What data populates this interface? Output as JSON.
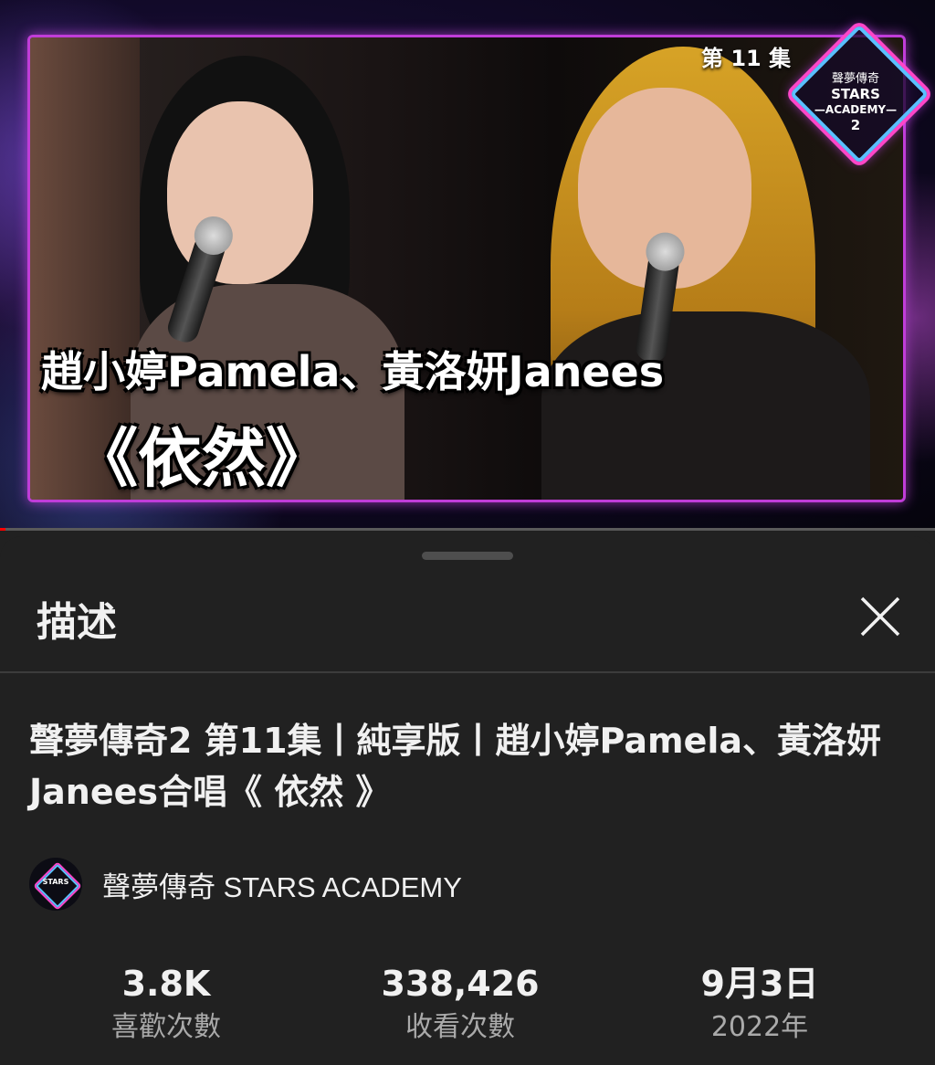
{
  "video": {
    "episode_badge": "第 11 集",
    "logo": {
      "line1": "聲夢傳奇",
      "line2": "STARS",
      "line3": "—ACADEMY—",
      "line4": "2"
    },
    "caption_names": "趙小婷Pamela、黃洛妍Janees",
    "caption_song": "《依然》",
    "progress_fraction": 0.006
  },
  "sheet": {
    "title": "描述",
    "close_icon": "close-icon"
  },
  "description": {
    "video_title": "聲夢傳奇2 第11集丨純享版丨趙小婷Pamela、黃洛妍Janees合唱《 依然 》",
    "channel_name": "聲夢傳奇 STARS ACADEMY",
    "channel_avatar_text": "STARS",
    "stats": [
      {
        "value": "3.8K",
        "label": "喜歡次數"
      },
      {
        "value": "338,426",
        "label": "收看次數"
      },
      {
        "value": "9月3日",
        "label": "2022年"
      }
    ]
  },
  "colors": {
    "background": "#212121",
    "frame_border": "#c03dd8",
    "progress": "#ff0000",
    "secondary_text": "#aaaaaa"
  }
}
